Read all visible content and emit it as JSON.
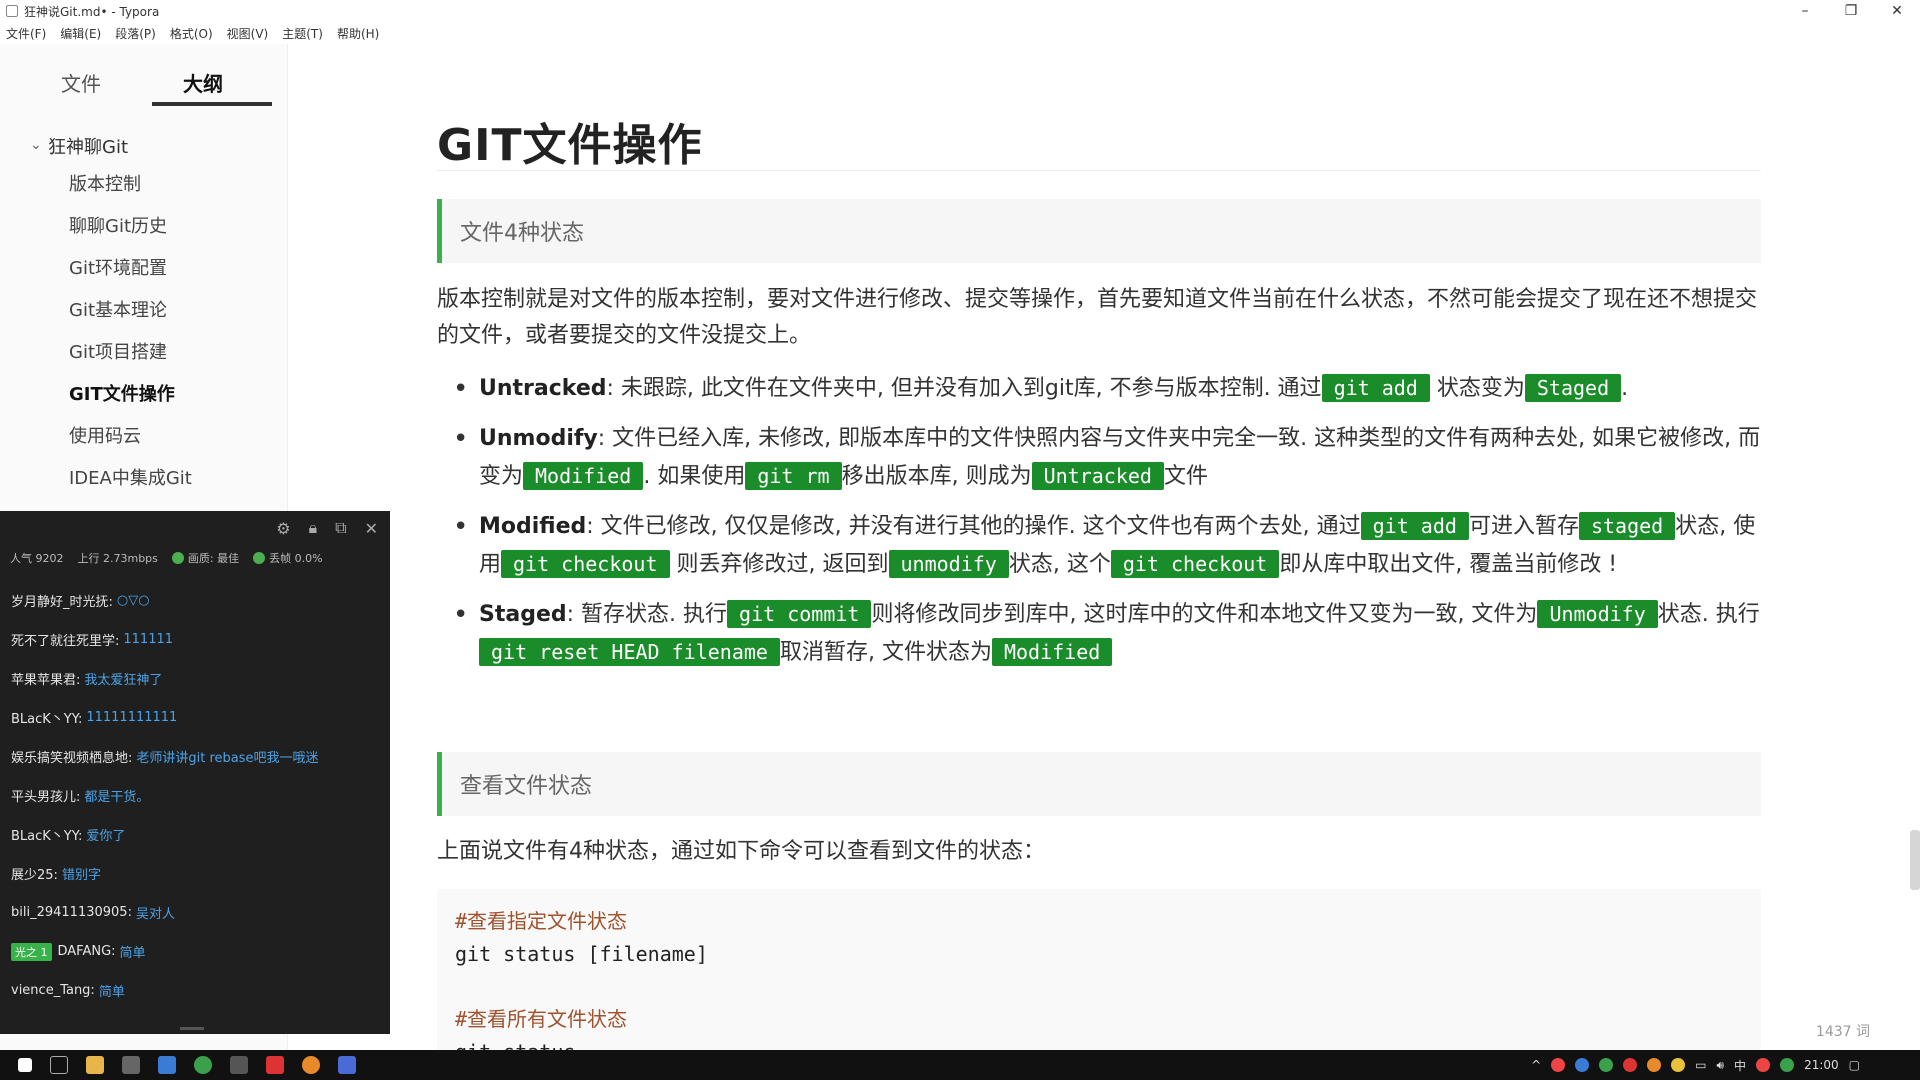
{
  "window": {
    "title": "狂神说Git.md• - Typora",
    "minimize": "–",
    "maximize": "❐",
    "close": "✕"
  },
  "menu": [
    "文件(F)",
    "编辑(E)",
    "段落(P)",
    "格式(O)",
    "视图(V)",
    "主题(T)",
    "帮助(H)"
  ],
  "sidebar": {
    "tabs": [
      {
        "label": "文件"
      },
      {
        "label": "大纲"
      }
    ],
    "active_tab": "大纲",
    "outline_root": "狂神聊Git",
    "outline_items": [
      "版本控制",
      "聊聊Git历史",
      "Git环境配置",
      "Git基本理论",
      "Git项目搭建",
      "GIT文件操作",
      "使用码云",
      "IDEA中集成Git"
    ],
    "active_item": "GIT文件操作"
  },
  "chat": {
    "stats": {
      "popularity": "人气 9202",
      "upload": "上行 2.73mbps",
      "quality": "画质: 最佳",
      "drop": "丢帧 0.0%"
    },
    "messages": [
      {
        "user": "岁月静好_时光抚:",
        "text": "○▽○"
      },
      {
        "user": "死不了就往死里学:",
        "text": "111111"
      },
      {
        "user": "苹果苹果君:",
        "text": "我太爱狂神了"
      },
      {
        "user": "BLacK丶YY:",
        "text": "11111111111"
      },
      {
        "user": "娱乐搞笑视频栖息地:",
        "text": "老师讲讲git rebase吧我一哦迷"
      },
      {
        "user": "平头男孩儿:",
        "text": "都是干货。"
      },
      {
        "user": "BLacK丶YY:",
        "text": "爱你了"
      },
      {
        "user": "展少25:",
        "text": "错别字"
      },
      {
        "user": "bili_29411130905:",
        "text": "吴对人"
      },
      {
        "user": "DAFANG:",
        "text": "简单",
        "badge": "光之 1"
      },
      {
        "user": "vience_Tang:",
        "text": "简单"
      }
    ]
  },
  "doc": {
    "title": "GIT文件操作",
    "section1": "文件4种状态",
    "intro": "版本控制就是对文件的版本控制，要对文件进行修改、提交等操作，首先要知道文件当前在什么状态，不然可能会提交了现在还不想提交的文件，或者要提交的文件没提交上。",
    "b1": {
      "term": "Untracked",
      "t1": ": 未跟踪, 此文件在文件夹中, 但并没有加入到git库, 不参与版本控制. 通过",
      "c1": "git add",
      "t2": " 状态变为",
      "c2": "Staged",
      "t3": "."
    },
    "b2": {
      "term": "Unmodify",
      "t1": ": 文件已经入库, 未修改, 即版本库中的文件快照内容与文件夹中完全一致. 这种类型的文件有两种去处, 如果它被修改, 而变为",
      "c1": "Modified",
      "t2": ". 如果使用",
      "c2": "git rm",
      "t3": "移出版本库, 则成为",
      "c3": "Untracked",
      "t4": "文件"
    },
    "b3": {
      "term": "Modified",
      "t1": ": 文件已修改, 仅仅是修改, 并没有进行其他的操作. 这个文件也有两个去处, 通过",
      "c1": "git add",
      "t2": "可进入暂存",
      "c2": "staged",
      "t3": "状态, 使用",
      "c3": "git checkout",
      "t4": " 则丢弃修改过, 返回到",
      "c4": "unmodify",
      "t5": "状态, 这个",
      "c5": "git checkout",
      "t6": "即从库中取出文件, 覆盖当前修改 !"
    },
    "b4": {
      "term": "Staged",
      "t1": ": 暂存状态. 执行",
      "c1": "git commit",
      "t2": "则将修改同步到库中, 这时库中的文件和本地文件又变为一致, 文件为",
      "c2": "Unmodify",
      "t3": "状态. 执行",
      "c3": "git reset HEAD filename",
      "t4": "取消暂存, 文件状态为",
      "c4": "Modified"
    },
    "section2": "查看文件状态",
    "para2": "上面说文件有4种状态，通过如下命令可以查看到文件的状态：",
    "code": {
      "c1": "#查看指定文件状态",
      "l1": "git status [filename]",
      "c2": "#查看所有文件状态",
      "l2": "git status"
    },
    "wordcount": "1437 词"
  },
  "taskbar": {
    "clock": "21:00",
    "ime": "中"
  },
  "colors": {
    "code_tag_bg": "#1a8c2a",
    "quote_border": "#3db04b",
    "chat_link": "#4aa3e8"
  }
}
